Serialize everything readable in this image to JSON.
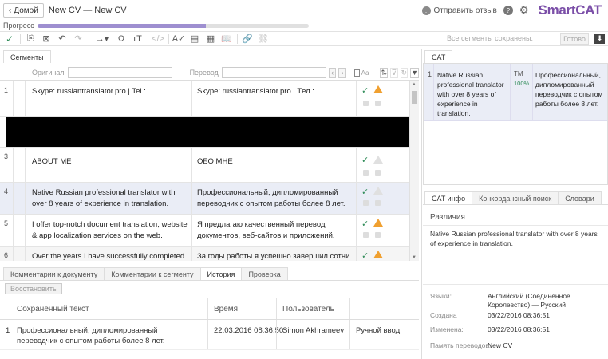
{
  "header": {
    "back_label": "Домой",
    "doc_title": "New CV — New CV",
    "feedback_label": "Отправить отзыв",
    "help_label": "?",
    "logo": "SmartCAT"
  },
  "progress": {
    "label": "Прогресс",
    "value_fraction": 0.62
  },
  "toolbar": {
    "status_text": "Все сегменты сохранены.",
    "done_label": "Готово"
  },
  "segments_tab": {
    "label": "Сегменты"
  },
  "filter": {
    "source_label": "Оригинал",
    "target_label": "Перевод",
    "case_label": "Аа"
  },
  "segments": [
    {
      "num": "1",
      "source": "Skype: russiantranslator.pro | Tel.:",
      "target": "Skype: russiantranslator.pro | Tел.:",
      "confirmed": true,
      "warning": true
    },
    {
      "num": "3",
      "source": "ABOUT ME",
      "target": "ОБО МНЕ",
      "confirmed": true,
      "warning": false
    },
    {
      "num": "4",
      "source": "Native Russian professional translator with over 8 years of experience in translation.",
      "target": "Профессиональный, дипломированный переводчик с опытом работы более 8 лет.",
      "confirmed": true,
      "warning": false
    },
    {
      "num": "5",
      "source": "I offer top-notch document translation, website & app localization services on the web.",
      "target": "Я предлагаю качественный перевод документов, веб-сайтов и приложений.",
      "confirmed": true,
      "warning": true
    },
    {
      "num": "6",
      "source": "Over the years I have successfully completed",
      "target": "За годы работы я успешно завершил сотни",
      "confirmed": true,
      "warning": true
    }
  ],
  "bottom_tabs": [
    {
      "label": "Комментарии к документу",
      "active": false
    },
    {
      "label": "Комментарии к сегменту",
      "active": false
    },
    {
      "label": "История",
      "active": true
    },
    {
      "label": "Проверка",
      "active": false
    }
  ],
  "history": {
    "restore_label": "Восстановить",
    "columns": [
      "Сохраненный текст",
      "Время",
      "Пользователь",
      ""
    ],
    "rows": [
      {
        "num": "1",
        "text": "Профессиональный, дипломированный переводчик с опытом работы более 8 лет.",
        "time": "22.03.2016 08:36:50",
        "user": "Simon Akhrameev",
        "type": "Ручной ввод"
      }
    ]
  },
  "cat": {
    "tab_label": "CAT",
    "match": {
      "num": "1",
      "source": "Native Russian professional translator with over 8 years of experience in translation.",
      "type": "TM",
      "percent": "100%",
      "target": "Профессиональный, дипломированный переводчик с опытом работы более 8 лет."
    }
  },
  "info_tabs": [
    {
      "label": "CAT инфо",
      "active": true
    },
    {
      "label": "Конкордансный поиск",
      "active": false
    },
    {
      "label": "Словари",
      "active": false
    }
  ],
  "info": {
    "diff_label": "Различия",
    "diff_text": "Native Russian professional translator with over 8 years of experience in translation.",
    "fields": [
      {
        "label": "Языки:",
        "value": "Английский (Соединенное Королевство) — Русский"
      },
      {
        "label": "Создана",
        "value": "03/22/2016 08:36:51"
      },
      {
        "label": "Изменена:",
        "value": "03/22/2016 08:36:51"
      },
      {
        "label": "Память переводов:",
        "value": "New CV"
      }
    ]
  }
}
